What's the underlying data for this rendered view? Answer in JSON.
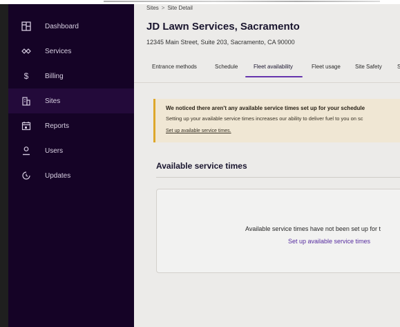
{
  "sidebar": {
    "items": [
      {
        "label": "Dashboard",
        "icon": "dashboard-icon"
      },
      {
        "label": "Services",
        "icon": "services-icon"
      },
      {
        "label": "Billing",
        "icon": "dollar-icon"
      },
      {
        "label": "Sites",
        "icon": "building-icon",
        "active": true
      },
      {
        "label": "Reports",
        "icon": "calendar-report-icon"
      },
      {
        "label": "Users",
        "icon": "user-icon"
      },
      {
        "label": "Updates",
        "icon": "clock-icon"
      }
    ]
  },
  "breadcrumb": {
    "root": "Sites",
    "separator": ">",
    "current": "Site Detail"
  },
  "site": {
    "name": "JD Lawn Services, Sacramento",
    "address": "12345 Main Street, Suite 203, Sacramento, CA 90000"
  },
  "tabs": [
    {
      "label": "Entrance methods"
    },
    {
      "label": "Schedule"
    },
    {
      "label": "Fleet availability",
      "active": true
    },
    {
      "label": "Fleet usage"
    },
    {
      "label": "Site Safety"
    },
    {
      "label": "S"
    }
  ],
  "alert": {
    "title": "We noticed there aren't any available service times set up for your schedule",
    "body": "Setting up your available service times increases our ability to deliver fuel to you on sc",
    "link": "Set up available service times."
  },
  "section": {
    "title": "Available service times",
    "empty_text": "Available service times have not been set up for t",
    "empty_link": "Set up available service times"
  },
  "colors": {
    "sidebar_bg": "#150326",
    "accent": "#6a37b5",
    "alert_border": "#e8ae2c",
    "alert_bg": "#faf1dd"
  }
}
